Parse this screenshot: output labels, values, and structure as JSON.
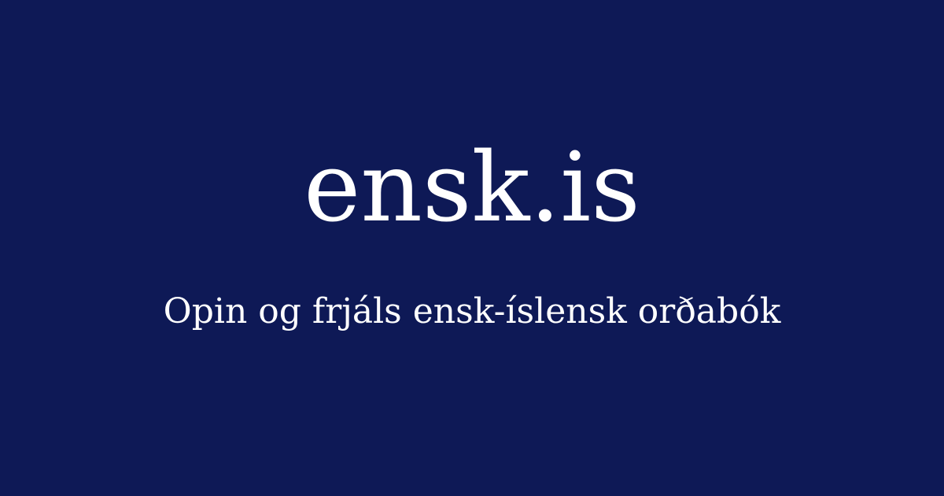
{
  "brand": {
    "title": "ensk.is",
    "tagline": "Opin og frjáls ensk-íslensk orðabók"
  },
  "colors": {
    "background": "#0e1956",
    "text": "#ffffff"
  }
}
